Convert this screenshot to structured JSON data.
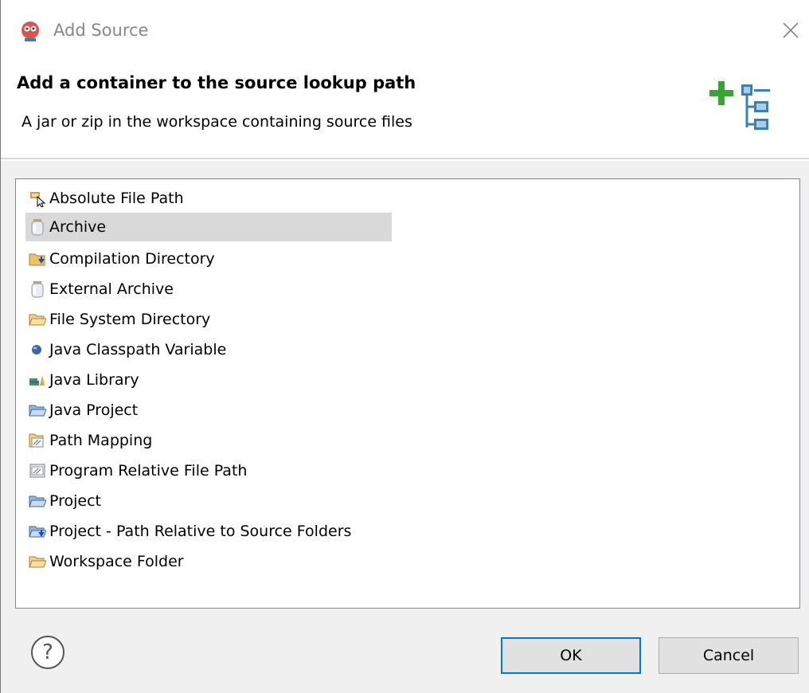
{
  "window": {
    "title": "Add Source"
  },
  "banner": {
    "title": "Add a container to the source lookup path",
    "description": "A jar or zip in the workspace containing source files"
  },
  "list": {
    "selected_index": 1,
    "items": [
      {
        "label": "Absolute File Path",
        "icon": "absolute-file-path-icon"
      },
      {
        "label": "Archive",
        "icon": "jar-icon"
      },
      {
        "label": "Compilation Directory",
        "icon": "compilation-folder-icon"
      },
      {
        "label": "External Archive",
        "icon": "jar-icon"
      },
      {
        "label": "File System Directory",
        "icon": "folder-icon"
      },
      {
        "label": "Java Classpath Variable",
        "icon": "classpath-variable-icon"
      },
      {
        "label": "Java Library",
        "icon": "library-icon"
      },
      {
        "label": "Java Project",
        "icon": "project-folder-icon"
      },
      {
        "label": "Path Mapping",
        "icon": "path-mapping-icon"
      },
      {
        "label": "Program Relative File Path",
        "icon": "program-path-icon"
      },
      {
        "label": "Project",
        "icon": "project-folder-icon"
      },
      {
        "label": "Project - Path Relative to Source Folders",
        "icon": "project-relative-icon"
      },
      {
        "label": "Workspace Folder",
        "icon": "folder-icon"
      }
    ]
  },
  "buttons": {
    "help": "?",
    "ok": "OK",
    "cancel": "Cancel"
  },
  "colors": {
    "selection": "#d9d9d9",
    "default_button_border": "#0078d7",
    "add_green": "#3aa335",
    "tree_blue": "#3c7fb1"
  }
}
